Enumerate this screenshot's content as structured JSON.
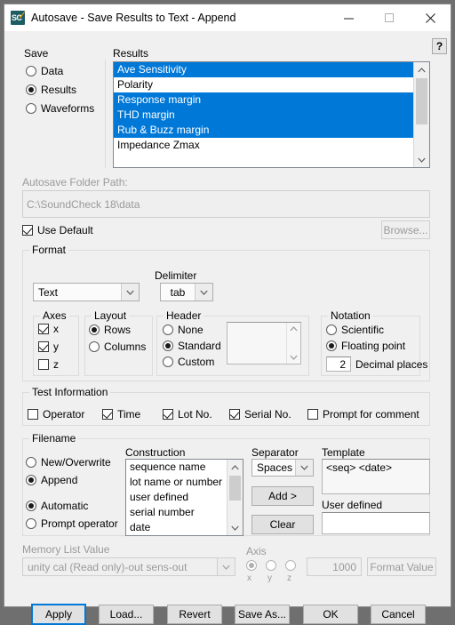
{
  "window": {
    "title": "Autosave  - Save Results to Text - Append",
    "icon_text": "SC",
    "minimize": "minimize-icon",
    "maximize": "maximize-icon",
    "close": "close-icon",
    "help_label": "?"
  },
  "save": {
    "group_label": "Save",
    "options": [
      {
        "label": "Data",
        "selected": false
      },
      {
        "label": "Results",
        "selected": true
      },
      {
        "label": "Waveforms",
        "selected": false
      }
    ]
  },
  "results": {
    "label": "Results",
    "items": [
      {
        "label": "Ave Sensitivity",
        "selected": true
      },
      {
        "label": "Polarity",
        "selected": false
      },
      {
        "label": "Response margin",
        "selected": true
      },
      {
        "label": "THD margin",
        "selected": true
      },
      {
        "label": "Rub & Buzz margin",
        "selected": true
      },
      {
        "label": "Impedance Zmax",
        "selected": false
      }
    ]
  },
  "folder": {
    "label": "Autosave Folder Path:",
    "path": "C:\\SoundCheck 18\\data",
    "use_default_label": "Use Default",
    "use_default_checked": true,
    "browse_label": "Browse..."
  },
  "format": {
    "group_label": "Format",
    "type_value": "Text",
    "delimiter_label": "Delimiter",
    "delimiter_value": "tab",
    "axes": {
      "group_label": "Axes",
      "items": [
        {
          "label": "x",
          "checked": true
        },
        {
          "label": "y",
          "checked": true
        },
        {
          "label": "z",
          "checked": false
        }
      ]
    },
    "layout": {
      "group_label": "Layout",
      "items": [
        {
          "label": "Rows",
          "selected": true
        },
        {
          "label": "Columns",
          "selected": false
        }
      ]
    },
    "header": {
      "group_label": "Header",
      "items": [
        {
          "label": "None",
          "selected": false
        },
        {
          "label": "Standard",
          "selected": true
        },
        {
          "label": "Custom",
          "selected": false
        }
      ],
      "custom_text": ""
    },
    "notation": {
      "group_label": "Notation",
      "items": [
        {
          "label": "Scientific",
          "selected": false
        },
        {
          "label": "Floating point",
          "selected": true
        }
      ],
      "decimal_places_value": "2",
      "decimal_places_label": "Decimal places"
    }
  },
  "test_information": {
    "group_label": "Test Information",
    "items": [
      {
        "label": "Operator",
        "checked": false
      },
      {
        "label": "Time",
        "checked": true
      },
      {
        "label": "Lot No.",
        "checked": true
      },
      {
        "label": "Serial No.",
        "checked": true
      },
      {
        "label": "Prompt for comment",
        "checked": false
      }
    ]
  },
  "filename": {
    "group_label": "Filename",
    "mode": [
      {
        "label": "New/Overwrite",
        "selected": false
      },
      {
        "label": "Append",
        "selected": true
      }
    ],
    "source": [
      {
        "label": "Automatic",
        "selected": true
      },
      {
        "label": "Prompt operator",
        "selected": false
      }
    ],
    "construction_label": "Construction",
    "construction_items": [
      "sequence name",
      "lot name or number",
      "user defined",
      "serial number",
      "date"
    ],
    "separator_label": "Separator",
    "separator_value": "Spaces",
    "add_label": "Add >",
    "clear_label": "Clear",
    "template_label": "Template",
    "template_value": "<seq> <date>",
    "user_defined_label": "User defined",
    "user_defined_value": ""
  },
  "memory_list": {
    "label": "Memory List Value",
    "value": "unity cal (Read only)-out sens-out",
    "axis_label": "Axis",
    "axis_options": [
      {
        "label": "x",
        "selected": true
      },
      {
        "label": "y",
        "selected": false
      },
      {
        "label": "z",
        "selected": false
      }
    ],
    "axis_value": "1000",
    "format_value_label": "Format Value"
  },
  "buttons": {
    "apply": "Apply",
    "load": "Load...",
    "revert": "Revert",
    "save_as": "Save As...",
    "ok": "OK",
    "cancel": "Cancel"
  },
  "colors": {
    "selection_blue": "#0078D7",
    "window_bg": "#F0F0F0",
    "titlebar_bg": "#FFFFFF",
    "desktop_bg": "#6F6F6F",
    "icon_teal": "#1C5C63",
    "icon_accent": "#F0A000"
  }
}
